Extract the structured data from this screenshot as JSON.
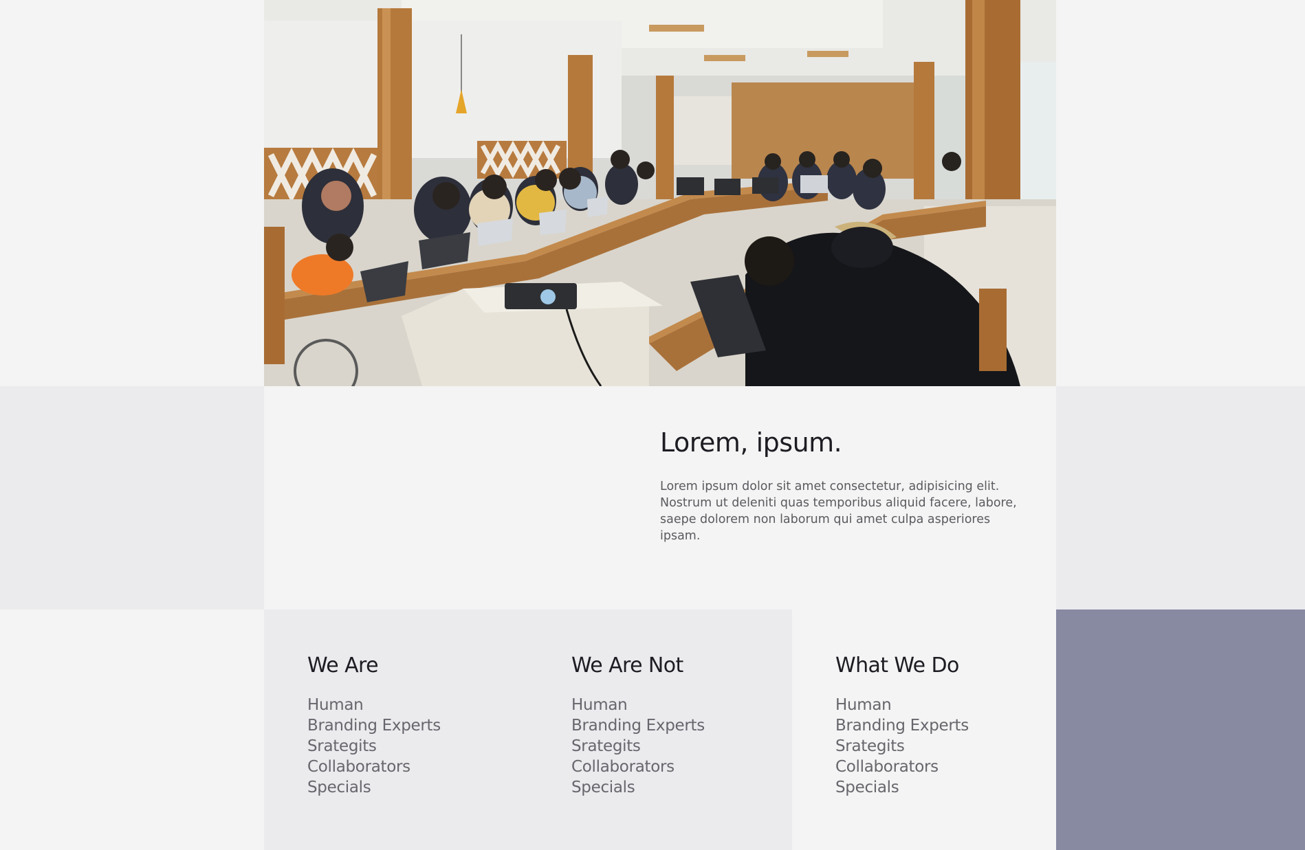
{
  "hero": {
    "image": "classroom-photo"
  },
  "intro": {
    "title": "Lorem, ipsum.",
    "body": "Lorem ipsum dolor sit amet consectetur, adipisicing elit. Nostrum ut deleniti quas temporibus aliquid facere, labore, saepe dolorem non laborum qui amet culpa asperiores ipsam."
  },
  "columns": [
    {
      "heading": "We Are",
      "items": [
        "Human",
        "Branding Experts",
        "Srategits",
        "Collaborators",
        "Specials"
      ]
    },
    {
      "heading": "We Are Not",
      "items": [
        "Human",
        "Branding Experts",
        "Srategits",
        "Collaborators",
        "Specials"
      ]
    },
    {
      "heading": "What We Do",
      "items": [
        "Human",
        "Branding Experts",
        "Srategits",
        "Collaborators",
        "Specials"
      ]
    }
  ],
  "colors": {
    "page_bg": "#f4f4f4",
    "band_bg": "#ebebee",
    "accent_block": "#878aa1",
    "heading_text": "#1c1c22",
    "body_text": "#66666c"
  }
}
